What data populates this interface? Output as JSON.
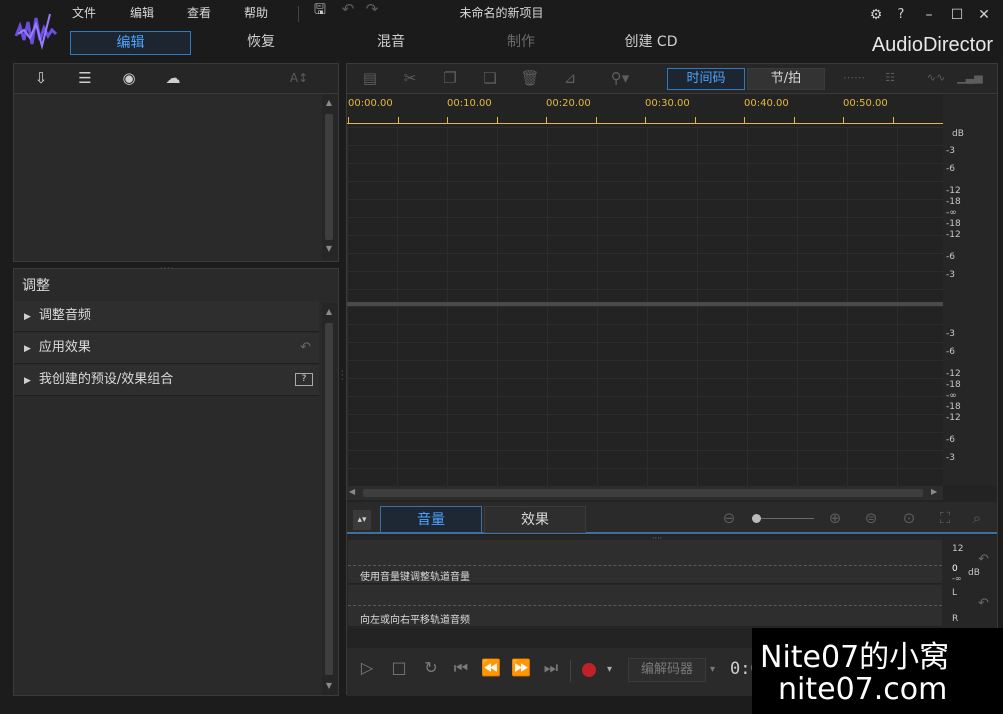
{
  "app": {
    "title": "未命名的新项目",
    "brand": "AudioDirector",
    "menu": [
      "文件",
      "编辑",
      "查看",
      "帮助"
    ],
    "modes": [
      {
        "label": "编辑",
        "state": "active"
      },
      {
        "label": "恢复",
        "state": "normal"
      },
      {
        "label": "混音",
        "state": "normal"
      },
      {
        "label": "制作",
        "state": "disabled"
      },
      {
        "label": "创建 CD",
        "state": "normal"
      }
    ],
    "window_buttons": [
      "gear-icon",
      "help-icon",
      "minimize-icon",
      "maximize-icon",
      "close-icon"
    ],
    "help_glyph": "?"
  },
  "library": {
    "toolbar_icons": [
      "import-media-icon",
      "export-list-icon",
      "globe-icon",
      "cloud-icon",
      "font-size-icon"
    ],
    "font_label": "A↕"
  },
  "adjust": {
    "header": "调整",
    "rows": [
      {
        "label": "调整音频"
      },
      {
        "label": "应用效果"
      },
      {
        "label": "我创建的预设/效果组合"
      }
    ]
  },
  "editor": {
    "toolbar_icons": [
      "clip-info-icon",
      "cut-icon",
      "copy-icon",
      "paste-icon",
      "delete-icon",
      "crop-icon",
      "marker-icon"
    ],
    "view_toggle": {
      "timecode": "时间码",
      "beat": "节/拍",
      "active": "timecode"
    },
    "ruler": [
      "00:00.00",
      "00:10.00",
      "00:20.00",
      "00:30.00",
      "00:40.00",
      "00:50.00"
    ],
    "db_unit": "dB",
    "db_track1": [
      "-3",
      "-6",
      "-12",
      "-18",
      "-∞",
      "-18",
      "-12",
      "-6",
      "-3"
    ],
    "db_track2": [
      "-3",
      "-6",
      "-12",
      "-18",
      "-∞",
      "-18",
      "-12",
      "-6",
      "-3"
    ]
  },
  "bottom": {
    "tabs": [
      {
        "label": "音量",
        "active": true
      },
      {
        "label": "效果",
        "active": false
      }
    ],
    "volume_lane_label": "使用音量键调整轨道音量",
    "pan_lane_label": "向左或向右平移轨道音频",
    "volume_scale": [
      "12",
      "0",
      "-∞"
    ],
    "volume_unit": "dB",
    "pan_scale": [
      "L",
      "R"
    ],
    "codec_label": "编解码器",
    "time_readout": "0:00:00:00"
  },
  "watermark": {
    "line1": "Nite07的小窝",
    "line2": "nite07.com"
  },
  "colors": {
    "accent": "#4da3ff",
    "ruler": "#e2b93b",
    "record": "#c0202a"
  }
}
